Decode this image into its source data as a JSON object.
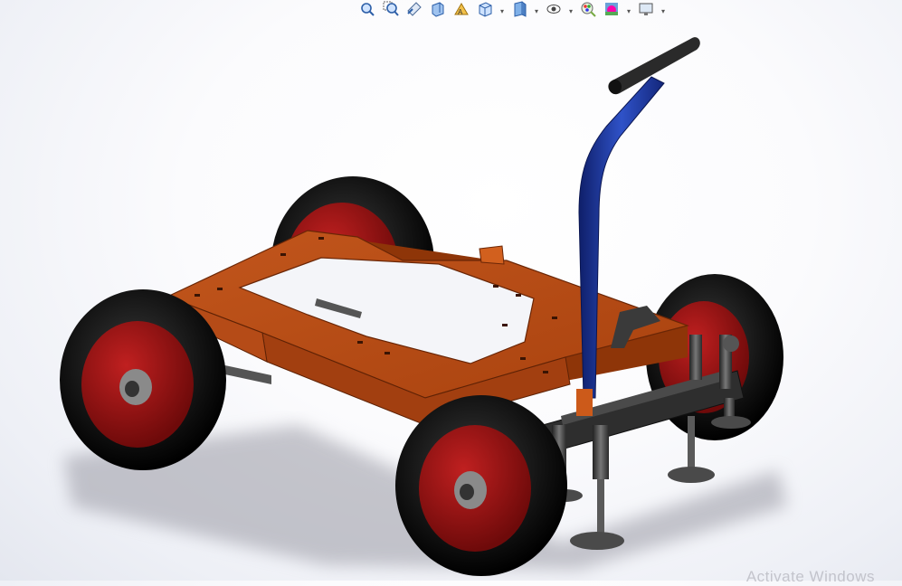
{
  "app": {
    "type": "cad-3d-viewport",
    "model": "four-wheel trolley / dolly assembly"
  },
  "toolbar": {
    "buttons": [
      {
        "icon": "zoom-to-fit-icon"
      },
      {
        "icon": "zoom-to-area-icon"
      },
      {
        "icon": "previous-view-icon"
      },
      {
        "icon": "section-view-icon"
      },
      {
        "icon": "dynamic-annotation-views-icon"
      },
      {
        "icon": "view-orientation-icon",
        "has_dropdown": true
      },
      {
        "icon": "display-style-icon",
        "has_dropdown": true
      },
      {
        "icon": "hide-show-items-icon",
        "has_dropdown": true
      },
      {
        "icon": "edit-appearance-icon"
      },
      {
        "icon": "apply-scene-icon",
        "has_dropdown": true
      },
      {
        "icon": "view-settings-icon",
        "has_dropdown": true
      }
    ]
  },
  "colors": {
    "frame": "#b84a12",
    "frame_dark": "#7a2e08",
    "handle": "#1f3a9e",
    "tire": "#1a1a1a",
    "rim": "#9c1414",
    "steel": "#3c3c3c"
  },
  "watermark": {
    "text": "Activate Windows"
  }
}
